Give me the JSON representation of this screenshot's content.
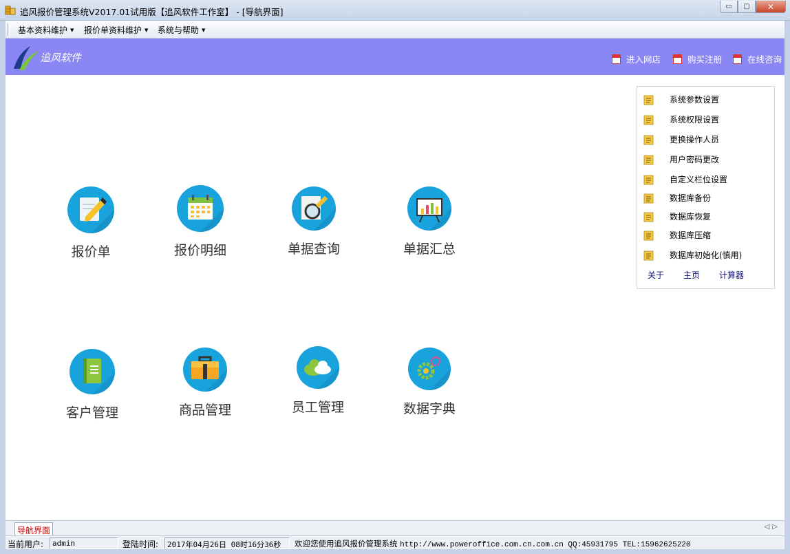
{
  "window": {
    "title": "追风报价管理系统V2017.01试用版【追风软件工作室】 - [导航界面]",
    "minimize_label": "▭",
    "restore_label": "▢",
    "close_label": "✕"
  },
  "menubar": {
    "items": [
      {
        "label": "基本资料维护"
      },
      {
        "label": "报价单资料维护"
      },
      {
        "label": "系统与帮助"
      }
    ]
  },
  "header": {
    "brand": "追风软件",
    "links": [
      {
        "label": "进入网店"
      },
      {
        "label": "购买注册"
      },
      {
        "label": "在线咨询"
      }
    ],
    "bg_color": "#8a86f4"
  },
  "tiles": [
    {
      "label": "报价单",
      "icon": "pencil-note-icon"
    },
    {
      "label": "报价明细",
      "icon": "calendar-icon"
    },
    {
      "label": "单据查询",
      "icon": "magnifier-icon"
    },
    {
      "label": "单据汇总",
      "icon": "presentation-chart-icon"
    },
    {
      "label": "客户管理",
      "icon": "notebook-icon"
    },
    {
      "label": "商品管理",
      "icon": "briefcase-icon"
    },
    {
      "label": "员工管理",
      "icon": "cloud-icon"
    },
    {
      "label": "数据字典",
      "icon": "gears-icon"
    }
  ],
  "sidepanel": {
    "items": [
      {
        "label": "系统参数设置"
      },
      {
        "label": "系统权限设置"
      },
      {
        "label": "更换操作人员"
      },
      {
        "label": "用户密码更改"
      },
      {
        "label": "自定义栏位设置"
      },
      {
        "label": "数据库备份"
      },
      {
        "label": "数据库恢复"
      },
      {
        "label": "数据库压缩"
      },
      {
        "label": "数据库初始化(慎用)"
      }
    ],
    "links": [
      {
        "label": "关于"
      },
      {
        "label": "主页"
      },
      {
        "label": "计算器"
      }
    ]
  },
  "tabs": {
    "active": "导航界面"
  },
  "status": {
    "user_label": "当前用户:",
    "user_value": "admin",
    "login_label": "登陆时间:",
    "login_value": "2017年04月26日 08时16分36秒",
    "welcome": "欢迎您使用追风报价管理系统",
    "contact": "http://www.poweroffice.com.cn.com.cn QQ:45931795 TEL:15962625220"
  }
}
